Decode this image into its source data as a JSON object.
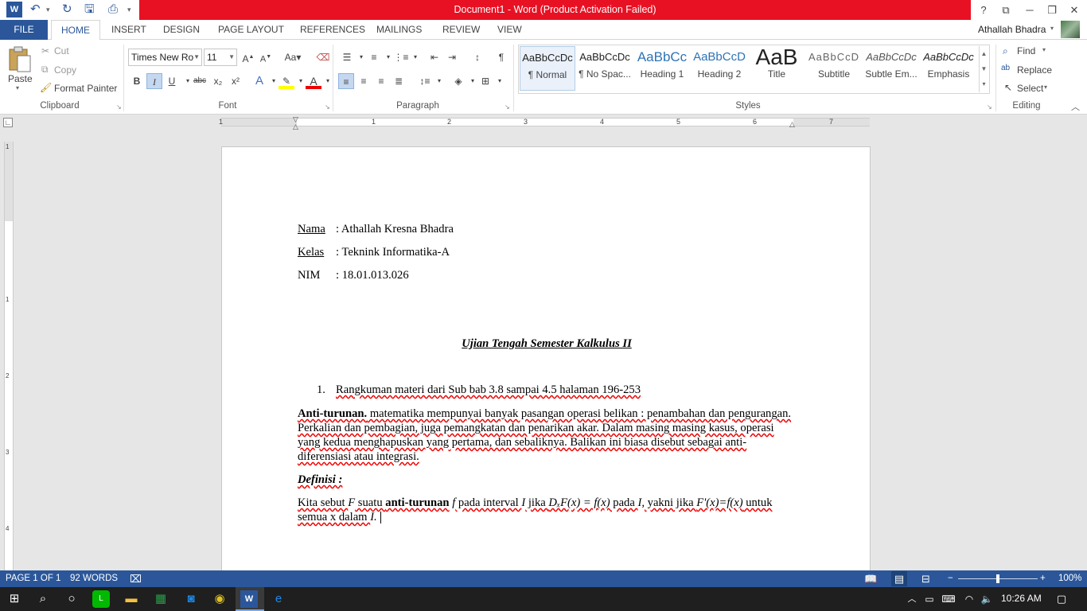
{
  "window": {
    "title": "Document1 -  Word (Product Activation Failed)",
    "accent": "#2b579a",
    "title_bar_color": "#e81123"
  },
  "qat": {
    "icons": [
      "word-logo-icon",
      "undo-icon",
      "redo-icon",
      "save-icon",
      "print-preview-icon"
    ]
  },
  "window_controls": {
    "help": "?",
    "ribbon_display": "⧉",
    "minimize": "─",
    "restore": "❐",
    "close": "✕"
  },
  "tabs": [
    "FILE",
    "HOME",
    "INSERT",
    "DESIGN",
    "PAGE LAYOUT",
    "REFERENCES",
    "MAILINGS",
    "REVIEW",
    "VIEW"
  ],
  "user": {
    "name": "Athallah Bhadra"
  },
  "clipboard": {
    "paste": "Paste",
    "cut": "Cut",
    "copy": "Copy",
    "format_painter": "Format Painter",
    "label": "Clipboard"
  },
  "font": {
    "name": "Times New Ro",
    "size": "11",
    "label": "Font",
    "bold": "B",
    "italic": "I",
    "underline": "U",
    "strike": "abc",
    "sub": "x₂",
    "sup": "x²"
  },
  "paragraph": {
    "label": "Paragraph"
  },
  "styles": {
    "label": "Styles",
    "items": [
      {
        "sample": "AaBbCcDc",
        "name": "¶ Normal"
      },
      {
        "sample": "AaBbCcDc",
        "name": "¶ No Spac..."
      },
      {
        "sample": "AaBbCc",
        "name": "Heading 1"
      },
      {
        "sample": "AaBbCcD",
        "name": "Heading 2"
      },
      {
        "sample": "AaB",
        "name": "Title"
      },
      {
        "sample": "AaBbCcD",
        "name": "Subtitle"
      },
      {
        "sample": "AaBbCcDc",
        "name": "Subtle Em..."
      },
      {
        "sample": "AaBbCcDc",
        "name": "Emphasis"
      }
    ]
  },
  "editing": {
    "label": "Editing",
    "find": "Find",
    "replace": "Replace",
    "select": "Select"
  },
  "ruler": {
    "marks": [
      "1",
      "1",
      "2",
      "3",
      "4",
      "5",
      "6",
      "7"
    ]
  },
  "vruler": {
    "marks": [
      "1",
      "1",
      "2",
      "3",
      "4"
    ]
  },
  "document": {
    "nama_label": "Nama",
    "nama_value": ": Athallah Kresna Bhadra",
    "kelas_label": "Kelas",
    "kelas_value": ": Teknink Informatika-A",
    "nim_label": "NIM",
    "nim_value": ": 18.01.013.026",
    "title": "Ujian Tengah Semester Kalkulus II",
    "list_num": "1.",
    "list_item": "Rangkuman materi dari Sub bab 3.8 sampai 4.5 halaman 196-253",
    "p1_bold": "Anti-turunan.",
    "p1_l1": " matematika mempunyai banyak pasangan operasi belikan : penambahan dan pengurangan.",
    "p1_l2": "Perkalian dan pembagian, juga pemangkatan dan penarikan akar. Dalam masing masing kasus, operasi",
    "p1_l3": "yang kedua menghapuskan yang pertama, dan sebaliknya. Balikan ini biasa disebut sebagai anti-",
    "p1_l4": "diferensiasi atau integrasi.",
    "definisi": "Definisi :",
    "p2_a": "Kita sebut ",
    "p2_F": "F",
    "p2_b": " suatu ",
    "p2_bold": "anti-turunan",
    "p2_c": " ",
    "p2_f": "f",
    "p2_d": " pada interval ",
    "p2_I": "I",
    "p2_e": " jika ",
    "p2_formula": "DₓF(x) = f(x)",
    "p2_g": " pada ",
    "p2_I2": "I,",
    "p2_h": " yakni jika ",
    "p2_formula2": "F'(x)=f(x)",
    "p2_i": " untuk",
    "p2_l2a": "semua x dalam ",
    "p2_l2b": "I."
  },
  "status": {
    "page": "PAGE 1 OF 1",
    "words": "92 WORDS",
    "zoom": "100%",
    "zoom_level": 0.5
  },
  "taskbar": {
    "time": "10:26 AM",
    "apps": [
      "windows-start-icon",
      "search-icon",
      "cortana-icon",
      "line-app-icon",
      "file-explorer-icon",
      "excel-icon",
      "outlook-icon",
      "chrome-icon",
      "word-icon",
      "edge-icon"
    ]
  }
}
